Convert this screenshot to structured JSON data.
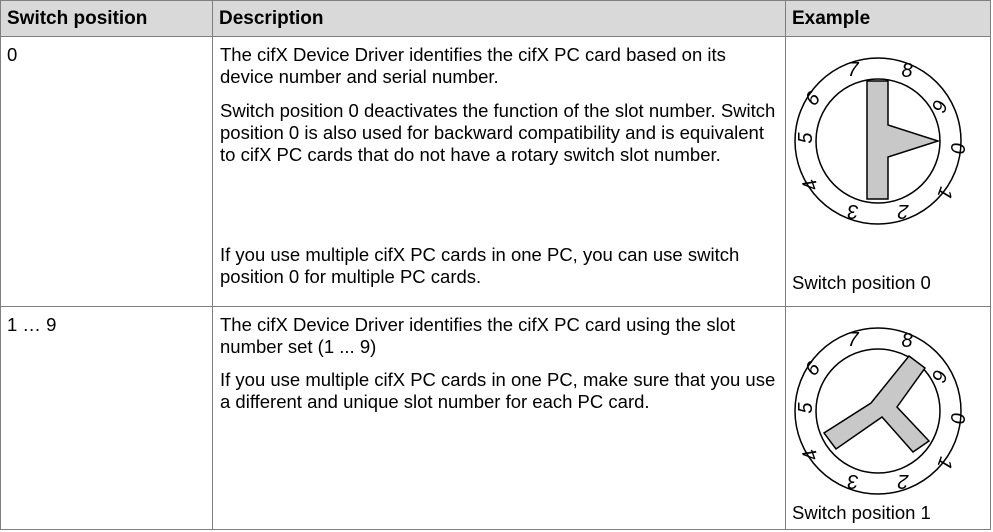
{
  "table": {
    "headers": {
      "switch_position": "Switch position",
      "description": "Description",
      "example": "Example"
    },
    "rows": [
      {
        "switch_position": "0",
        "paragraphs": [
          "The cifX Device Driver identifies the cifX PC card based on its device number and serial number.",
          "Switch position 0 deactivates the function of the slot number. Switch position 0 is also used for backward compatibility and is equivalent to cifX PC cards that do not have a rotary switch slot number.",
          "If you use multiple cifX PC cards in one PC, you can use switch position 0 for multiple PC cards."
        ],
        "example_caption": "Switch position 0",
        "dial_position": 0
      },
      {
        "switch_position": "1 … 9",
        "paragraphs": [
          "The cifX Device Driver identifies the cifX PC card using the slot number set (1 ... 9)",
          "If you use multiple cifX PC cards in one PC, make sure that you use a different and unique slot number for each PC card."
        ],
        "example_caption": "Switch position 1",
        "dial_position": 1
      }
    ]
  },
  "colors": {
    "header_background": "#d9d9d9",
    "border": "#7f7f7f",
    "dial_fill": "#c8c8c8"
  },
  "dial_digits": [
    "7",
    "8",
    "9",
    "0",
    "1",
    "2",
    "3",
    "4",
    "5",
    "6"
  ]
}
